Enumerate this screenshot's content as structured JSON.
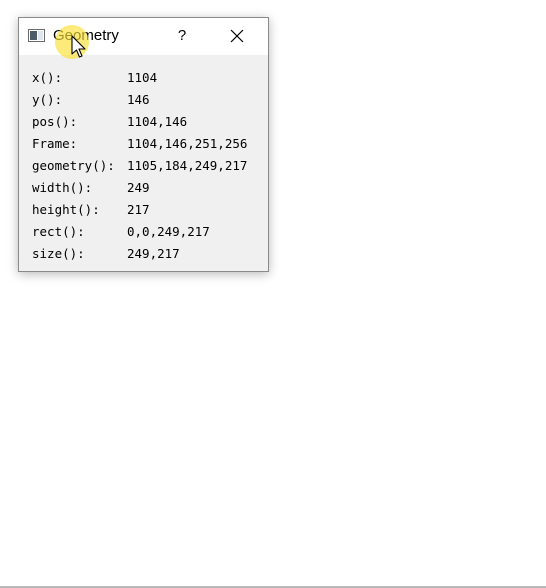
{
  "window": {
    "title": "Geometry",
    "help_label": "?",
    "close_icon": "close-icon",
    "app_icon": "window-icon"
  },
  "rows": [
    {
      "label": "x():",
      "value": "1104"
    },
    {
      "label": "y():",
      "value": "146"
    },
    {
      "label": "pos():",
      "value": "1104,146"
    },
    {
      "label": "Frame:",
      "value": "1104,146,251,256"
    },
    {
      "label": "geometry():",
      "value": "1105,184,249,217"
    },
    {
      "label": "width():",
      "value": "249"
    },
    {
      "label": "height():",
      "value": "217"
    },
    {
      "label": "rect():",
      "value": "0,0,249,217"
    },
    {
      "label": "size():",
      "value": "249,217"
    }
  ],
  "colors": {
    "titlebar": "#ffffff",
    "client_area": "#f0f0f0",
    "cursor_highlight": "#fae132"
  }
}
